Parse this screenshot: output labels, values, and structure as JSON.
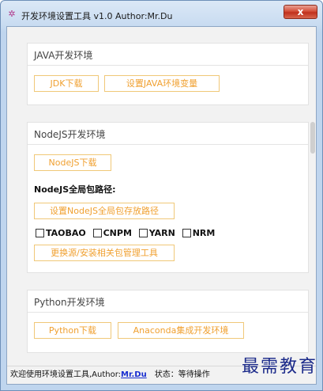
{
  "window": {
    "title": "开发环境设置工具 v1.0 Author:Mr.Du",
    "close_label": "x"
  },
  "java": {
    "title": "JAVA开发环境",
    "jdk_download": "JDK下载",
    "set_env": "设置JAVA环境变量"
  },
  "nodejs": {
    "title": "NodeJS开发环境",
    "download": "NodeJS下载",
    "global_path_label": "NodeJS全局包路径:",
    "set_global_path": "设置NodeJS全局包存放路径",
    "registries": [
      {
        "label": "TAOBAO",
        "checked": false
      },
      {
        "label": "CNPM",
        "checked": false
      },
      {
        "label": "YARN",
        "checked": false
      },
      {
        "label": "NRM",
        "checked": false
      }
    ],
    "install_tool": "更换源/安装相关包管理工具"
  },
  "python": {
    "title": "Python开发环境",
    "download": "Python下载",
    "anaconda": "Anaconda集成开发环境"
  },
  "status": {
    "welcome": "欢迎使用环境设置工具,Author:",
    "author": "Mr.Du",
    "state": "状态：等待操作"
  },
  "watermark": "最需教育"
}
